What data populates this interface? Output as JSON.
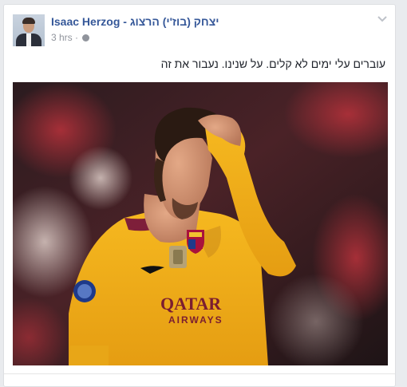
{
  "post": {
    "author": "Isaac Herzog - יצחק (בוז'י) הרצוג",
    "time": "3 hrs",
    "separator": "·",
    "text": "עוברים עלי ימים לא קלים. על שנינו. נעבור את זה",
    "privacy_icon": "globe-icon",
    "menu_icon": "chevron-down-icon"
  },
  "photo": {
    "shirt_sponsor": "QATAR",
    "shirt_sponsor_line2": "AIRWAYS"
  },
  "colors": {
    "link": "#365899",
    "meta": "#90949c",
    "jersey": "#f5b31a"
  }
}
